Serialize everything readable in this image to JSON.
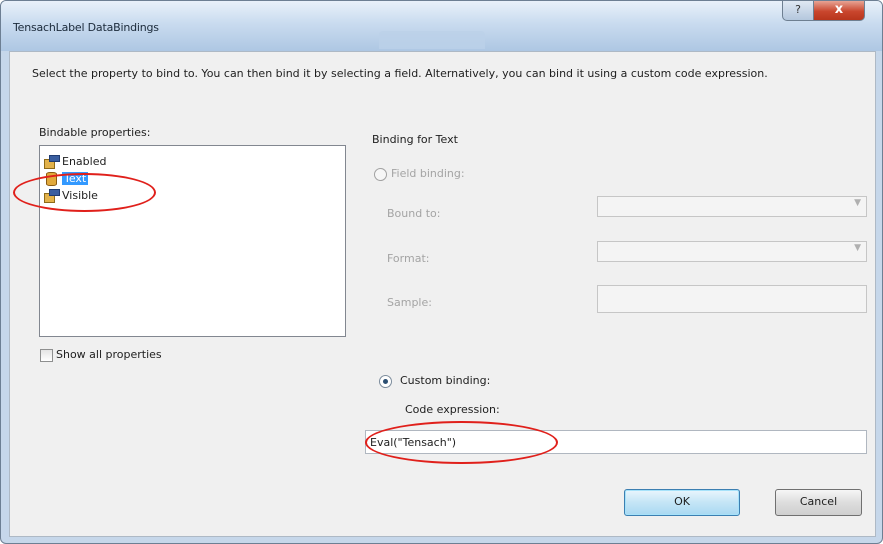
{
  "window": {
    "title": "TensachLabel DataBindings",
    "help_label": "?",
    "close_label": "x"
  },
  "description": "Select the property to bind to. You can then bind it by selecting a field. Alternatively, you can bind it using a custom code expression.",
  "bindable_properties": {
    "label": "Bindable properties:",
    "items": [
      {
        "label": "Enabled",
        "icon": "property-icon",
        "selected": false
      },
      {
        "label": "Text",
        "icon": "database-binding-icon",
        "selected": true
      },
      {
        "label": "Visible",
        "icon": "property-icon",
        "selected": false
      }
    ],
    "show_all_label": "Show all properties",
    "show_all_checked": false
  },
  "binding_panel": {
    "heading": "Binding for Text",
    "field_binding": {
      "label": "Field binding:",
      "bound_to_label": "Bound to:",
      "format_label": "Format:",
      "sample_label": "Sample:",
      "bound_to_value": "",
      "format_value": "",
      "sample_value": ""
    },
    "custom_binding": {
      "label": "Custom binding:",
      "selected": true,
      "code_expression_label": "Code expression:",
      "code_expression_value": "Eval(\"Tensach\")"
    }
  },
  "buttons": {
    "ok": "OK",
    "cancel": "Cancel"
  },
  "colors": {
    "highlight_ellipse": "#e0201b",
    "selection": "#3399ff"
  }
}
